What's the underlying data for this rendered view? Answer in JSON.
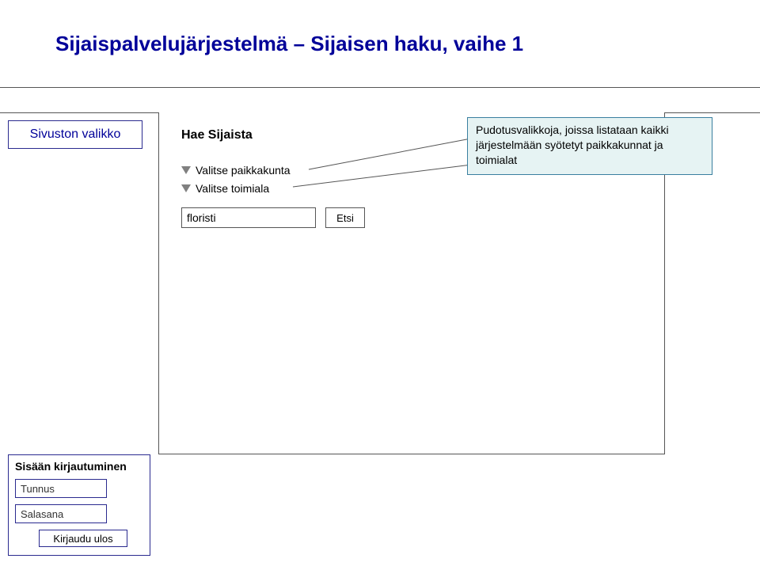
{
  "title": "Sijaispalvelujärjestelmä – Sijaisen haku, vaihe 1",
  "sidebar": {
    "label": "Sivuston valikko"
  },
  "form": {
    "heading": "Hae Sijaista",
    "dropdowns": [
      {
        "label": "Valitse paikkakunta"
      },
      {
        "label": "Valitse toimiala"
      }
    ],
    "search_value": "floristi",
    "search_button": "Etsi"
  },
  "callout": {
    "text": "Pudotusvalikkoja, joissa listataan kaikki järjestelmään syötetyt paikkakunnat ja toimialat"
  },
  "login": {
    "title": "Sisään kirjautuminen",
    "username_label": "Tunnus",
    "password_label": "Salasana",
    "logout_button": "Kirjaudu ulos"
  }
}
